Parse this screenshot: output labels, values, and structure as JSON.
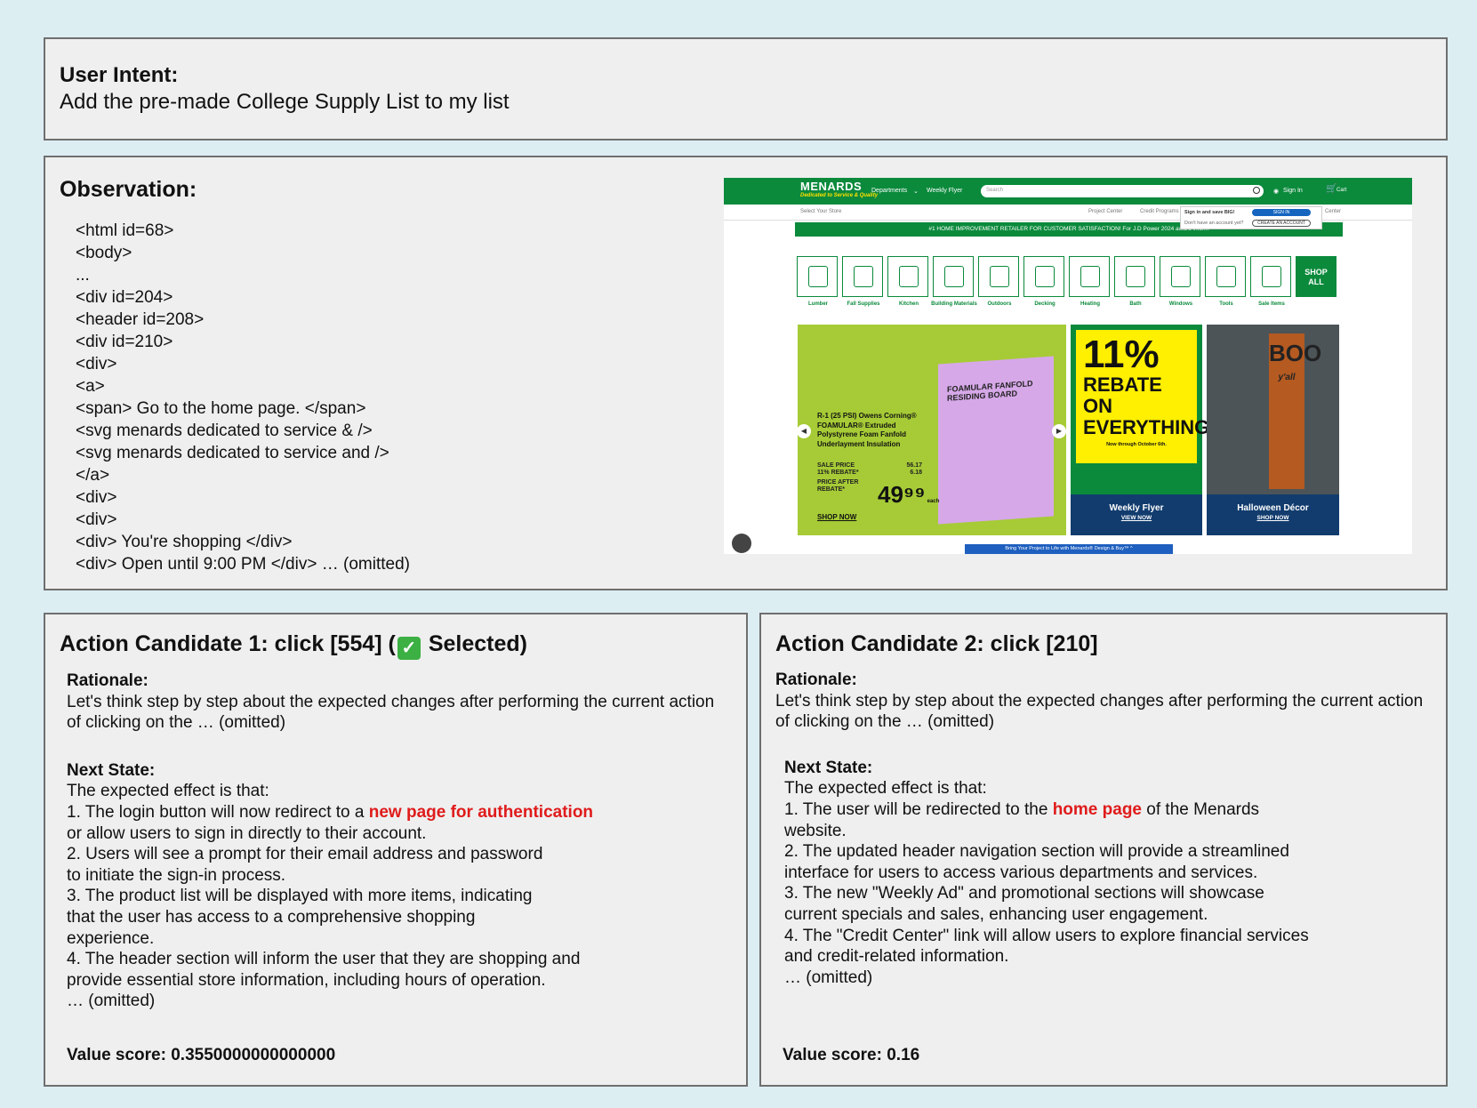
{
  "intent": {
    "heading": "User Intent:",
    "text": "Add the pre-made College Supply List to my list"
  },
  "observation": {
    "heading": "Observation:",
    "code_lines": [
      "<html id=68>",
      "<body>",
      "...",
      "<div id=204>",
      "<header id=208>",
      "<div id=210>",
      "<div>",
      "<a>",
      "<span> Go to the home page. </span>",
      "<svg menards dedicated to service & />",
      "<svg menards dedicated to service and />",
      "</a>",
      "<div>",
      "<div>",
      "<div> You're shopping </div>",
      "<div> Open until 9:00 PM </div> … (omitted)"
    ]
  },
  "screenshot": {
    "logo": "MENARDS",
    "logo_tagline": "Dedicated to Service & Quality",
    "nav": {
      "departments": "Departments",
      "weekly_flyer": "Weekly Flyer",
      "sign_in": "Sign In",
      "cart": "Cart"
    },
    "search_placeholder": "Search",
    "subbar": {
      "select_store": "Select Your Store",
      "project_center": "Project Center",
      "credit_programs": "Credit Programs",
      "center": "Center"
    },
    "signin_popup": {
      "prompt": "Sign in and save BIG!",
      "no_account": "Don't have an account yet?",
      "sign_in_button": "SIGN IN",
      "create_button": "CREATE AN ACCOUNT"
    },
    "banner": "#1 HOME IMPROVEMENT RETAILER FOR CUSTOMER SATISFACTION! For J.D Power 2024 award inform",
    "categories": [
      "Lumber",
      "Fall Supplies",
      "Kitchen",
      "Building Materials",
      "Outdoors",
      "Decking",
      "Heating",
      "Bath",
      "Windows",
      "Tools",
      "Sale Items"
    ],
    "shop_all": "SHOP ALL",
    "promo1": {
      "title": "R-1 (25 PSI) Owens Corning® FOAMULAR® Extruded Polystyrene Foam Fanfold Underlayment Insulation",
      "sale_price_label": "SALE PRICE",
      "sale_price": "56.17",
      "rebate_label": "11% REBATE*",
      "rebate": "6.18",
      "after_label": "PRICE AFTER REBATE*",
      "price": "49⁹⁹",
      "each": "each",
      "shop": "SHOP NOW",
      "board_title": "FOAMULAR FANFOLD RESIDING BOARD"
    },
    "promo2": {
      "big": "11%",
      "mid": "REBATE ON EVERYTHING!*",
      "small": "Now through October 6th.",
      "footer": "Weekly Flyer",
      "link": "VIEW NOW"
    },
    "promo3": {
      "boo": "BOO",
      "yall": "y'all",
      "footer": "Halloween Décor",
      "link": "SHOP NOW"
    },
    "bottom_tab": "Bring Your Project to Life with Menards® Design & Buy™ ^"
  },
  "candidate1": {
    "title_prefix": "Action Candidate 1: click [554] (",
    "title_suffix": " Selected)",
    "rationale_label": "Rationale:",
    "rationale": "Let's think step by step about the expected changes after performing the current action of clicking on the … (omitted)",
    "next_state_label": "Next State:",
    "intro": "The expected effect is that:",
    "l1a": "1. The login button will now redirect to a ",
    "l1red": "new page for authentication",
    "l1b": "or allow users to sign in directly to their account.",
    "l2a": "2. Users will see a prompt for their email address and password",
    "l2b": "to initiate the sign-in process.",
    "l3a": "3. The product list will be displayed with more items, indicating",
    "l3b": "that the user has access to a comprehensive shopping",
    "l3c": "experience.",
    "l4a": "4. The header section will inform the user that they are shopping and",
    "l4b": "provide essential store information, including hours of operation.",
    "omitted": "… (omitted)",
    "score": "Value score: 0.3550000000000000"
  },
  "candidate2": {
    "title": "Action Candidate 2: click [210]",
    "rationale_label": "Rationale:",
    "rationale": "Let's think step by step about the expected changes after performing the current action of clicking on the … (omitted)",
    "next_state_label": "Next State:",
    "intro": "The expected effect is that:",
    "l1a": "1. The user will be redirected to the ",
    "l1red": "home page",
    "l1c": " of the Menards",
    "l1b": "website.",
    "l2a": "2. The updated header navigation section will provide a streamlined",
    "l2b": "interface for users to access various departments and services.",
    "l3a": "3. The new \"Weekly Ad\" and promotional sections will showcase",
    "l3b": "current specials and sales, enhancing user engagement.",
    "l4a": "4. The \"Credit Center\" link will allow users to explore financial services",
    "l4b": "and credit-related information.",
    "omitted": "… (omitted)",
    "score": "Value score: 0.16"
  }
}
